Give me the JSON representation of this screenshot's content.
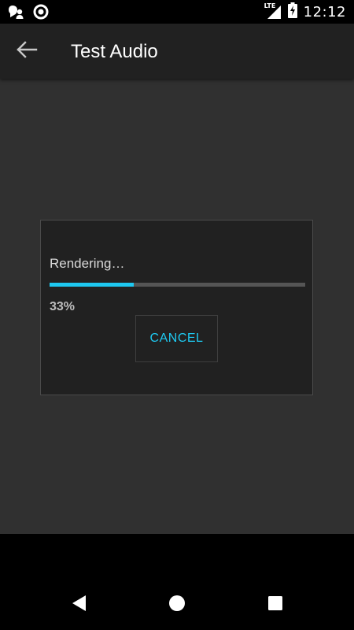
{
  "status_bar": {
    "network": "LTE",
    "time": "12:12"
  },
  "app_bar": {
    "title": "Test Audio",
    "back_icon": "arrow-back-icon"
  },
  "dialog": {
    "title": "Rendering…",
    "progress_percent": 33,
    "progress_label": "33%",
    "cancel_label": "CANCEL"
  },
  "nav_bar": {
    "back_icon": "nav-back-icon",
    "home_icon": "nav-home-icon",
    "recents_icon": "nav-recents-icon"
  },
  "colors": {
    "accent": "#1ec8f0",
    "app_bar": "#212121",
    "background": "#303030",
    "dialog": "#212121"
  }
}
